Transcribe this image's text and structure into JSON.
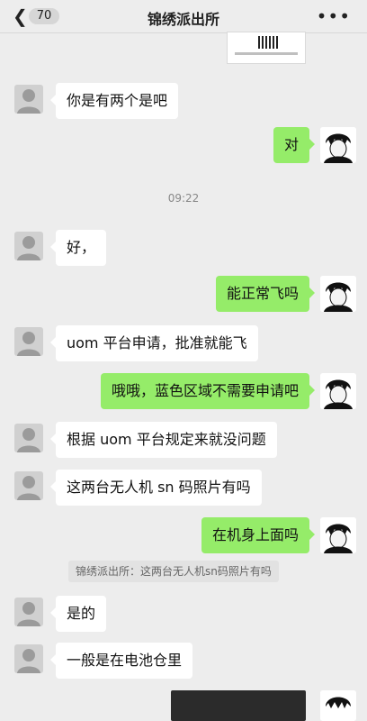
{
  "header": {
    "unread_count": "70",
    "title": "锦绣派出所"
  },
  "timestamp": "09:22",
  "quote_text": "锦绣派出所：这两台无人机sn码照片有吗",
  "messages": [
    {
      "side": "in",
      "text": "你是有两个是吧"
    },
    {
      "side": "out",
      "text": "对"
    },
    {
      "side": "in",
      "text": "好，"
    },
    {
      "side": "out",
      "text": "能正常飞吗"
    },
    {
      "side": "in",
      "text": "uom 平台申请，批准就能飞"
    },
    {
      "side": "out",
      "text": "哦哦，蓝色区域不需要申请吧"
    },
    {
      "side": "in",
      "text": "根据 uom 平台规定来就没问题"
    },
    {
      "side": "in",
      "text": "这两台无人机 sn 码照片有吗"
    },
    {
      "side": "out",
      "text": "在机身上面吗"
    },
    {
      "side": "in",
      "text": "是的"
    },
    {
      "side": "in",
      "text": "一般是在电池仓里"
    }
  ],
  "icons": {
    "back": "chevron-left-icon",
    "more": "more-dots-icon",
    "avatar_left": "default-avatar-icon",
    "avatar_right": "anime-avatar-icon"
  }
}
